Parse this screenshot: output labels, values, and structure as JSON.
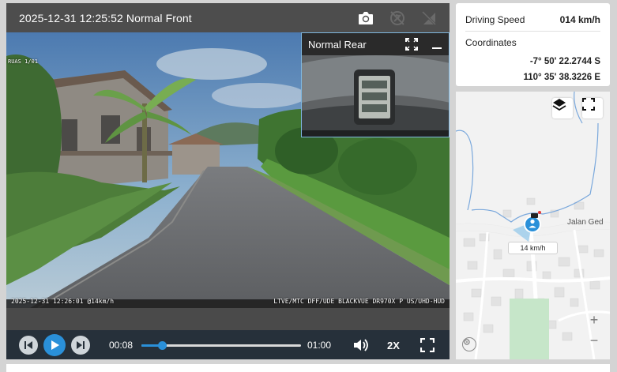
{
  "player": {
    "title": "2025-12-31 12:25:52 Normal Front",
    "icons": [
      "camera-icon",
      "no-gps-icon",
      "no-signal-icon"
    ],
    "osd_top": "RUAS 1/01",
    "osd_bottom_left": "2025-12-31 12:26:01 @14km/h",
    "osd_bottom_right": "LTVE/MTC DFF/UDE BLACKVUE DR970X P US/UHD-HUD",
    "rear": {
      "title": "Normal Rear"
    },
    "controls": {
      "current_time": "00:08",
      "total_time": "01:00",
      "progress": 0.13,
      "playback_speed": "2X"
    }
  },
  "info": {
    "speed_label": "Driving Speed",
    "speed_value": "014 km/h",
    "coords_label": "Coordinates",
    "latitude": "-7° 50' 22.2744 S",
    "longitude": "110° 35' 38.3226 E"
  },
  "map": {
    "road_label": "Jalan Ged",
    "speed_tag": "14 km/h",
    "zoom_in": "+",
    "zoom_out": "−"
  },
  "colors": {
    "accent": "#2a90d9",
    "control_bar": "#26303a",
    "header": "#4d4d4d"
  }
}
